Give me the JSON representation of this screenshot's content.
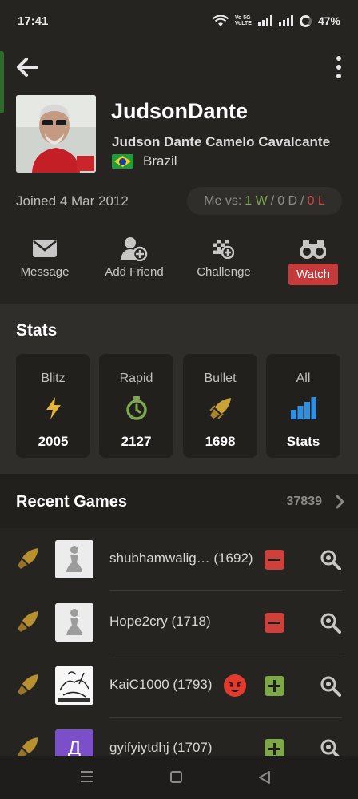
{
  "status_bar": {
    "time": "17:41",
    "network_top": "Vo 5G",
    "network_bottom": "VoLTE",
    "battery": "47%"
  },
  "profile": {
    "username": "JudsonDante",
    "full_name": "Judson Dante Camelo Cavalcante",
    "country": "Brazil",
    "joined": "Joined 4 Mar 2012",
    "record": {
      "prefix": "Me vs:",
      "wins": "1 W",
      "draws": "0 D",
      "losses": "0 L",
      "sep": "/"
    }
  },
  "actions": [
    {
      "label": "Message",
      "icon": "envelope-icon"
    },
    {
      "label": "Add Friend",
      "icon": "add-friend-icon"
    },
    {
      "label": "Challenge",
      "icon": "challenge-icon"
    },
    {
      "label": "Watch",
      "icon": "binoculars-icon"
    }
  ],
  "stats": {
    "title": "Stats",
    "cards": [
      {
        "name": "Blitz",
        "value": "2005",
        "icon": "lightning-icon"
      },
      {
        "name": "Rapid",
        "value": "2127",
        "icon": "stopwatch-icon"
      },
      {
        "name": "Bullet",
        "value": "1698",
        "icon": "bullet-icon"
      },
      {
        "name": "All",
        "value": "Stats",
        "icon": "bar-chart-icon"
      }
    ]
  },
  "recent_games": {
    "title": "Recent Games",
    "count": "37839",
    "games": [
      {
        "opponent": "shubhamwalig…",
        "rating": "(1692)",
        "result": "loss"
      },
      {
        "opponent": "Hope2cry",
        "rating": "(1718)",
        "result": "loss"
      },
      {
        "opponent": "KaiC1000",
        "rating": "(1793)",
        "result": "win"
      },
      {
        "opponent": "gyifyiytdhj",
        "rating": "(1707)",
        "result": "win",
        "avatar_letter": "Д"
      }
    ]
  },
  "colors": {
    "accent_green": "#7fa650",
    "loss_red": "#d0403a",
    "watch_red": "#c53b3b",
    "stat_gold": "#c9a23a",
    "stat_blue": "#2f8fe0"
  }
}
